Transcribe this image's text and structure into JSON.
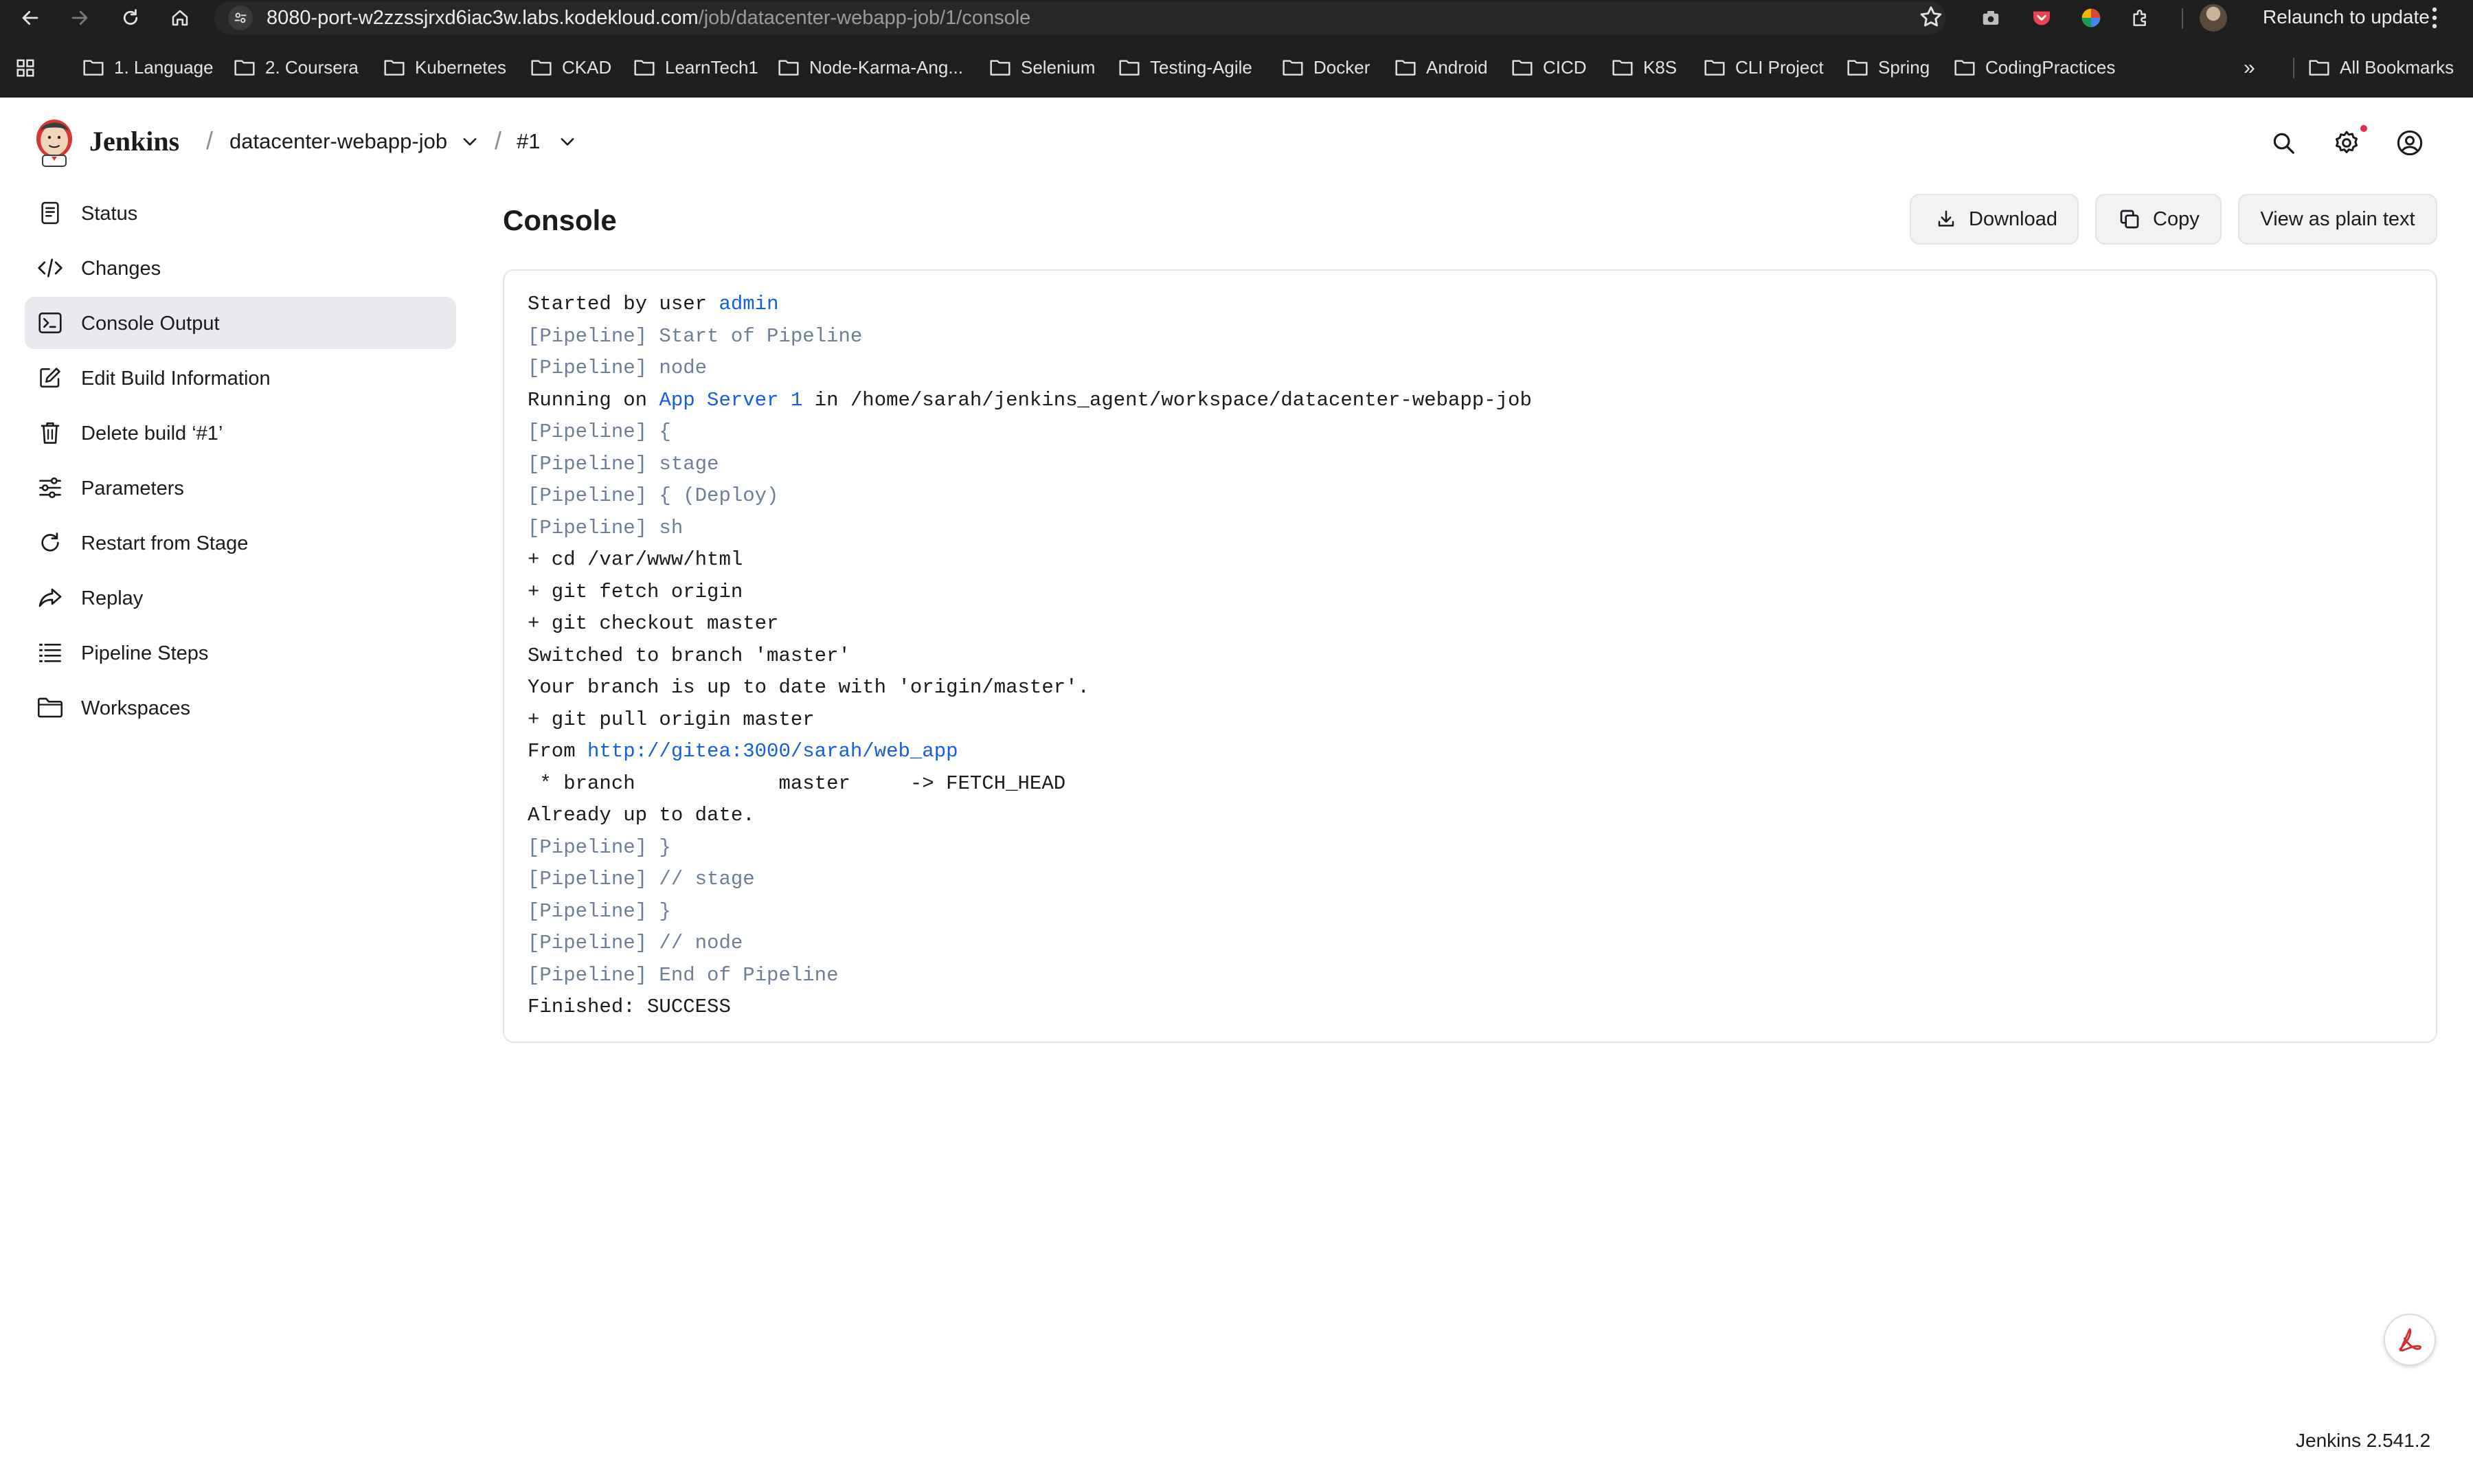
{
  "browser": {
    "url_host": "8080-port-w2zzssjrxd6iac3w.labs.kodekloud.com",
    "url_path": "/job/datacenter-webapp-job/1/console",
    "relaunch_label": "Relaunch to update",
    "bookmarks": [
      {
        "label": "1. Language"
      },
      {
        "label": "2. Coursera"
      },
      {
        "label": "Kubernetes"
      },
      {
        "label": "CKAD"
      },
      {
        "label": "LearnTech1"
      },
      {
        "label": "Node-Karma-Ang..."
      },
      {
        "label": "Selenium"
      },
      {
        "label": "Testing-Agile"
      },
      {
        "label": "Docker"
      },
      {
        "label": "Android"
      },
      {
        "label": "CICD"
      },
      {
        "label": "K8S"
      },
      {
        "label": "CLI Project"
      },
      {
        "label": "Spring"
      },
      {
        "label": "CodingPractices"
      }
    ],
    "more_label": "»",
    "all_bookmarks_label": "All Bookmarks"
  },
  "header": {
    "brand": "Jenkins",
    "breadcrumb": [
      {
        "label": "datacenter-webapp-job"
      },
      {
        "label": "#1"
      }
    ],
    "separator": "/"
  },
  "sidebar": {
    "items": [
      {
        "label": "Status",
        "icon": "status-icon"
      },
      {
        "label": "Changes",
        "icon": "code-icon"
      },
      {
        "label": "Console Output",
        "icon": "terminal-icon",
        "active": true
      },
      {
        "label": "Edit Build Information",
        "icon": "edit-icon"
      },
      {
        "label": "Delete build ‘#1’",
        "icon": "trash-icon"
      },
      {
        "label": "Parameters",
        "icon": "sliders-icon"
      },
      {
        "label": "Restart from Stage",
        "icon": "restart-icon"
      },
      {
        "label": "Replay",
        "icon": "replay-icon"
      },
      {
        "label": "Pipeline Steps",
        "icon": "list-icon"
      },
      {
        "label": "Workspaces",
        "icon": "folder-icon"
      }
    ]
  },
  "main": {
    "title": "Console",
    "actions": {
      "download": "Download",
      "copy": "Copy",
      "plain_text": "View as plain text"
    },
    "console": {
      "started_prefix": "Started by user ",
      "started_user": "admin",
      "lines": [
        "[Pipeline] Start of Pipeline",
        "[Pipeline] node",
        "Running on ",
        "App Server 1",
        " in /home/sarah/jenkins_agent/workspace/datacenter-webapp-job",
        "[Pipeline] {",
        "[Pipeline] stage",
        "[Pipeline] { (Deploy)",
        "[Pipeline] sh",
        "+ cd /var/www/html",
        "+ git fetch origin",
        "+ git checkout master",
        "Switched to branch 'master'",
        "Your branch is up to date with 'origin/master'.",
        "+ git pull origin master",
        "From ",
        "http://gitea:3000/sarah/web_app",
        " * branch            master     -> FETCH_HEAD",
        "Already up to date.",
        "[Pipeline] }",
        "[Pipeline] // stage",
        "[Pipeline] }",
        "[Pipeline] // node",
        "[Pipeline] End of Pipeline",
        "Finished: SUCCESS"
      ]
    }
  },
  "footer": {
    "version": "Jenkins 2.541.2"
  },
  "colors": {
    "link": "#1460d8",
    "pipeline_text": "#6d7e99",
    "active_nav_bg": "#e9e9ee",
    "chrome_bg": "#1f1f1f"
  }
}
